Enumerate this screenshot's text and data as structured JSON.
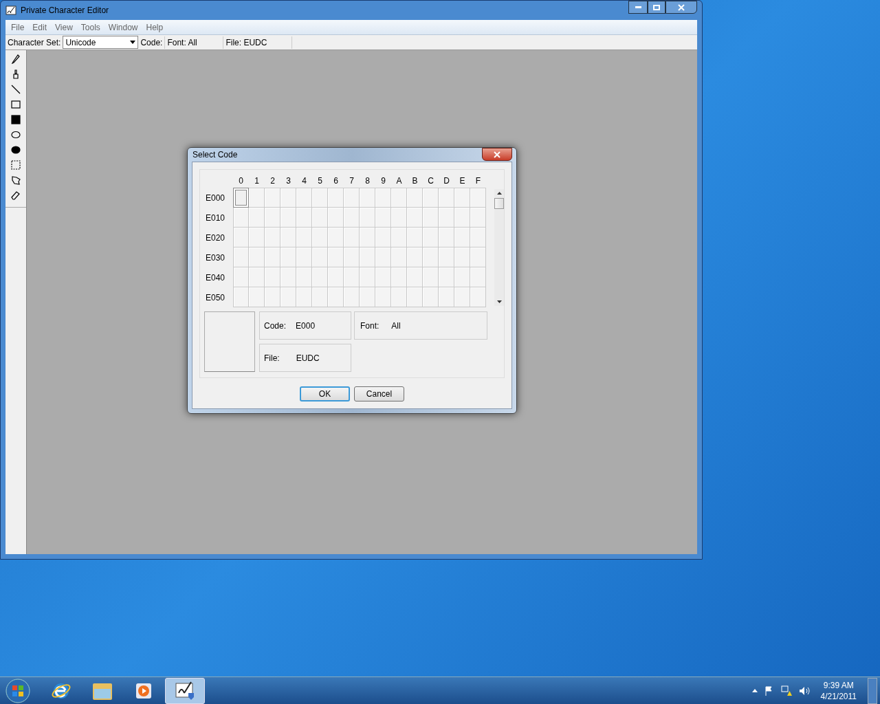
{
  "window": {
    "title": "Private Character Editor"
  },
  "menu": [
    "File",
    "Edit",
    "View",
    "Tools",
    "Window",
    "Help"
  ],
  "toolbar": {
    "charset_label": "Character Set:",
    "charset_value": "Unicode",
    "code_label": "Code:",
    "font_label": "Font: All",
    "file_label": "File: EUDC"
  },
  "tools": [
    {
      "kind": "pencil",
      "selected": false
    },
    {
      "kind": "brush",
      "selected": false
    },
    {
      "kind": "line",
      "selected": false
    },
    {
      "kind": "rect",
      "selected": false
    },
    {
      "kind": "filled-rect",
      "selected": false
    },
    {
      "kind": "ellipse",
      "selected": false
    },
    {
      "kind": "filled-ellipse",
      "selected": false
    },
    {
      "kind": "rect-select",
      "selected": false
    },
    {
      "kind": "freeform-select",
      "selected": false
    },
    {
      "kind": "eraser",
      "selected": false
    }
  ],
  "dialog": {
    "title": "Select Code",
    "column_headers": [
      "0",
      "1",
      "2",
      "3",
      "4",
      "5",
      "6",
      "7",
      "8",
      "9",
      "A",
      "B",
      "C",
      "D",
      "E",
      "F"
    ],
    "rows": [
      {
        "label": "E000",
        "cells": [
          {
            "selected": true
          },
          {
            "selected": false
          },
          {
            "selected": false
          },
          {
            "selected": false
          },
          {
            "selected": false
          },
          {
            "selected": false
          },
          {
            "selected": false
          },
          {
            "selected": false
          },
          {
            "selected": false
          },
          {
            "selected": false
          },
          {
            "selected": false
          },
          {
            "selected": false
          },
          {
            "selected": false
          },
          {
            "selected": false
          },
          {
            "selected": false
          },
          {
            "selected": false
          }
        ]
      },
      {
        "label": "E010",
        "cells": [
          {
            "selected": false
          },
          {
            "selected": false
          },
          {
            "selected": false
          },
          {
            "selected": false
          },
          {
            "selected": false
          },
          {
            "selected": false
          },
          {
            "selected": false
          },
          {
            "selected": false
          },
          {
            "selected": false
          },
          {
            "selected": false
          },
          {
            "selected": false
          },
          {
            "selected": false
          },
          {
            "selected": false
          },
          {
            "selected": false
          },
          {
            "selected": false
          },
          {
            "selected": false
          }
        ]
      },
      {
        "label": "E020",
        "cells": [
          {
            "selected": false
          },
          {
            "selected": false
          },
          {
            "selected": false
          },
          {
            "selected": false
          },
          {
            "selected": false
          },
          {
            "selected": false
          },
          {
            "selected": false
          },
          {
            "selected": false
          },
          {
            "selected": false
          },
          {
            "selected": false
          },
          {
            "selected": false
          },
          {
            "selected": false
          },
          {
            "selected": false
          },
          {
            "selected": false
          },
          {
            "selected": false
          },
          {
            "selected": false
          }
        ]
      },
      {
        "label": "E030",
        "cells": [
          {
            "selected": false
          },
          {
            "selected": false
          },
          {
            "selected": false
          },
          {
            "selected": false
          },
          {
            "selected": false
          },
          {
            "selected": false
          },
          {
            "selected": false
          },
          {
            "selected": false
          },
          {
            "selected": false
          },
          {
            "selected": false
          },
          {
            "selected": false
          },
          {
            "selected": false
          },
          {
            "selected": false
          },
          {
            "selected": false
          },
          {
            "selected": false
          },
          {
            "selected": false
          }
        ]
      },
      {
        "label": "E040",
        "cells": [
          {
            "selected": false
          },
          {
            "selected": false
          },
          {
            "selected": false
          },
          {
            "selected": false
          },
          {
            "selected": false
          },
          {
            "selected": false
          },
          {
            "selected": false
          },
          {
            "selected": false
          },
          {
            "selected": false
          },
          {
            "selected": false
          },
          {
            "selected": false
          },
          {
            "selected": false
          },
          {
            "selected": false
          },
          {
            "selected": false
          },
          {
            "selected": false
          },
          {
            "selected": false
          }
        ]
      },
      {
        "label": "E050",
        "cells": [
          {
            "selected": false
          },
          {
            "selected": false
          },
          {
            "selected": false
          },
          {
            "selected": false
          },
          {
            "selected": false
          },
          {
            "selected": false
          },
          {
            "selected": false
          },
          {
            "selected": false
          },
          {
            "selected": false
          },
          {
            "selected": false
          },
          {
            "selected": false
          },
          {
            "selected": false
          },
          {
            "selected": false
          },
          {
            "selected": false
          },
          {
            "selected": false
          },
          {
            "selected": false
          }
        ]
      }
    ],
    "code_label": "Code:",
    "code_value": "E000",
    "font_label": "Font:",
    "font_value": "All",
    "file_label": "File:",
    "file_value": "EUDC",
    "buttons": [
      {
        "label": "OK",
        "default": true
      },
      {
        "label": "Cancel",
        "default": false
      }
    ]
  },
  "taskbar": {
    "buttons": [
      {
        "kind": "browser",
        "selected": false
      },
      {
        "kind": "folder",
        "selected": false
      },
      {
        "kind": "media",
        "selected": false
      },
      {
        "kind": "editor",
        "selected": true
      }
    ],
    "time": "9:39 AM",
    "date": "4/21/2011"
  }
}
